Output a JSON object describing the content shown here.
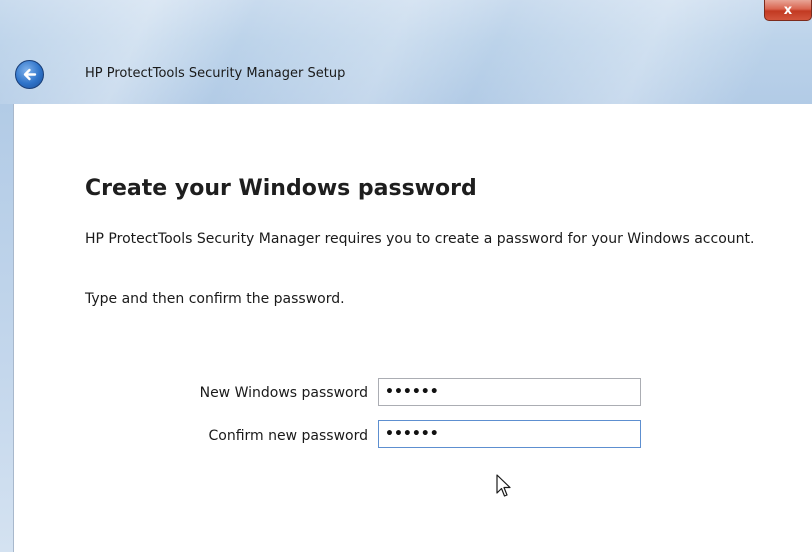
{
  "window": {
    "title": "HP ProtectTools Security Manager Setup",
    "close_label": "x"
  },
  "page": {
    "heading": "Create your Windows password",
    "description": "HP ProtectTools Security Manager requires you to create a password for your Windows account.",
    "instruction": "Type and then confirm the password."
  },
  "form": {
    "new_password": {
      "label": "New Windows password",
      "value": "••••••"
    },
    "confirm_password": {
      "label": "Confirm new password",
      "value": "••••••"
    }
  },
  "icons": {
    "back": "back-arrow-icon",
    "close": "close-icon",
    "cursor": "mouse-pointer-icon"
  },
  "colors": {
    "title_bar": "#c9dbee",
    "close_button": "#c23a22",
    "back_button": "#2e73c9"
  }
}
